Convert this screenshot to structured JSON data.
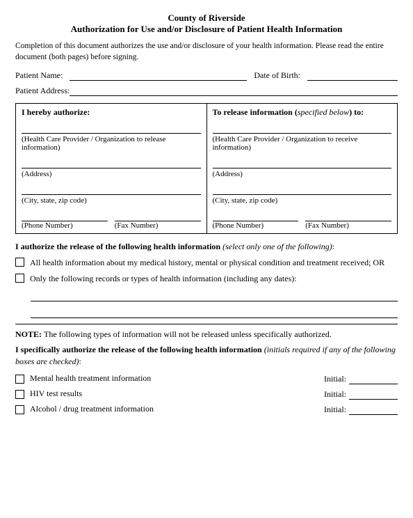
{
  "header": {
    "county": "County of Riverside",
    "title": "Authorization for Use and/or Disclosure of Patient Health Information"
  },
  "intro": {
    "text": "Completion of this document authorizes the use and/or disclosure of your health information.  Please read the entire document (both pages) before signing."
  },
  "fields": {
    "patient_name_label": "Patient Name:",
    "dob_label": "Date of Birth:",
    "address_label": "Patient Address:"
  },
  "auth_table": {
    "left_header": "I hereby authorize:",
    "right_header": "To release information (",
    "right_header_em": "specified below",
    "right_header_end": ") to:",
    "left_sub1_label": "(Health Care Provider / Organization to release information)",
    "left_sub2_label": "(Address)",
    "left_sub3_label": "(City, state, zip code)",
    "left_phone_label": "(Phone Number)",
    "left_fax_label": "(Fax Number)",
    "right_sub1_label": "(Health Care Provider / Organization to receive information)",
    "right_sub2_label": "(Address)",
    "right_sub3_label": "(City, state, zip code)",
    "right_phone_label": "(Phone Number)",
    "right_fax_label": "(Fax Number)"
  },
  "release_section": {
    "title_bold": "I authorize the release of the following health information",
    "title_italic": " (select only one of the following)",
    "title_end": ":",
    "option1": "All health information about my medical history, mental or physical condition and treatment received; OR",
    "option2": "Only the following records or types of health information (including any dates):"
  },
  "note_section": {
    "note_label": "NOTE: ",
    "note_text": " The following types of information will not be released unless specifically authorized.",
    "specific_bold": "I specifically authorize the release of the following health information",
    "specific_italic": " (initials required if any of the following boxes are checked)",
    "specific_end": ":",
    "items": [
      {
        "label": "Mental health treatment information",
        "initial_label": "Initial:"
      },
      {
        "label": "HIV test results",
        "initial_label": "Initial:"
      },
      {
        "label": "Alcohol / drug treatment information",
        "initial_label": "Initial:"
      }
    ]
  }
}
